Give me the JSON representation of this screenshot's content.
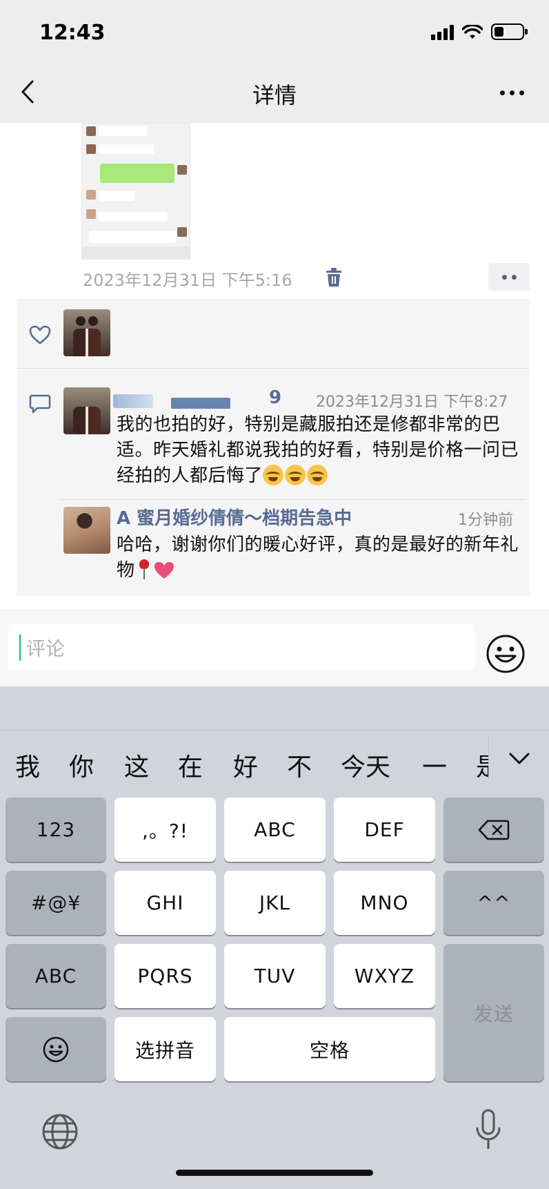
{
  "status_bar": {
    "time": "12:43",
    "battery_level": 0.35
  },
  "nav": {
    "title": "详情",
    "back_icon": "chevron-left-icon",
    "more_icon": "more-icon"
  },
  "post": {
    "timestamp": "2023年12月31日 下午5:16",
    "delete_icon": "trash-icon",
    "action_icon": "more-dots-icon"
  },
  "likes": {
    "icon": "heart-outline-icon"
  },
  "comments": [
    {
      "name": "9",
      "time": "2023年12月31日 下午8:27",
      "text": "我的也拍的好，特别是藏服拍还是修都非常的巴适。昨天婚礼都说我拍的好看，特别是价格一问已经拍的人都后悔了"
    }
  ],
  "reply": {
    "name": "A 蜜月婚纱倩倩～档期告急中",
    "time": "1分钟前",
    "text": "哈哈，谢谢你们的暖心好评，真的是最好的新年礼物"
  },
  "comment_input": {
    "placeholder": "评论"
  },
  "keyboard": {
    "candidates": [
      "我",
      "你",
      "这",
      "在",
      "好",
      "不",
      "今天",
      "一",
      "是"
    ],
    "keys": {
      "num": "123",
      "punct": ",。?!",
      "abc": "ABC",
      "def": "DEF",
      "symbols": "#@¥",
      "ghi": "GHI",
      "jkl": "JKL",
      "mno": "MNO",
      "kaomoji": "^^",
      "abc_mode": "ABC",
      "pqrs": "PQRS",
      "tuv": "TUV",
      "wxyz": "WXYZ",
      "send": "发送",
      "pinyin": "选拼音",
      "space": "空格"
    }
  },
  "colors": {
    "link": "#576b95",
    "accent": "#07c160",
    "heart": "#e94e77"
  }
}
